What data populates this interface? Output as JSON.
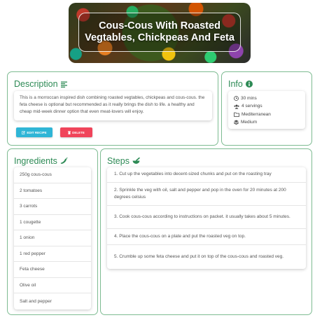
{
  "hero": {
    "title": "Cous-Cous With Roasted Vegtables, Chickpeas And Feta"
  },
  "description": {
    "heading": "Description",
    "text": "This is a morroccan inspired dish combining roasted vegtables, chickpeas and cous-cous. the feta cheese is optional but recommended as it really brings the dish to life. a healthy and cheap mid-week dinner option that even meat-lovers will enjoy.",
    "edit_label": "EDIT RECIPE",
    "delete_label": "DELETE"
  },
  "info": {
    "heading": "Info",
    "time": "30 mins",
    "servings": "4 servings",
    "cuisine": "Mediterranean",
    "difficulty": "Medium"
  },
  "ingredients": {
    "heading": "Ingredients",
    "items": [
      "250g cous-cous",
      "2 tomatoes",
      "3 carrots",
      "1 cougette",
      "1 onion",
      "1 red pepper",
      "Feta cheese",
      "Olive oil",
      "Salt and pepper"
    ]
  },
  "steps": {
    "heading": "Steps",
    "items": [
      "1. Cut up the vegetables into decent-sized chunks and put on the roasting tray",
      "2. Sprinkle the veg with oil, salt and pepper and pop in the oven for 20 minutes at 200 degrees celsius",
      "3. Cook cous-cous according to instructions on packet. it usually takes about 5 minutes.",
      "4. Place the cous-cous on a plate and put the roasted veg on top.",
      "5. Crumble up some feta cheese and put it on top of the cous-cous and roasted veg."
    ]
  },
  "colors": {
    "accent": "#2d8a55",
    "border": "#7dbb91",
    "edit_button": "#2fb5d6",
    "delete_button": "#f0445a"
  }
}
